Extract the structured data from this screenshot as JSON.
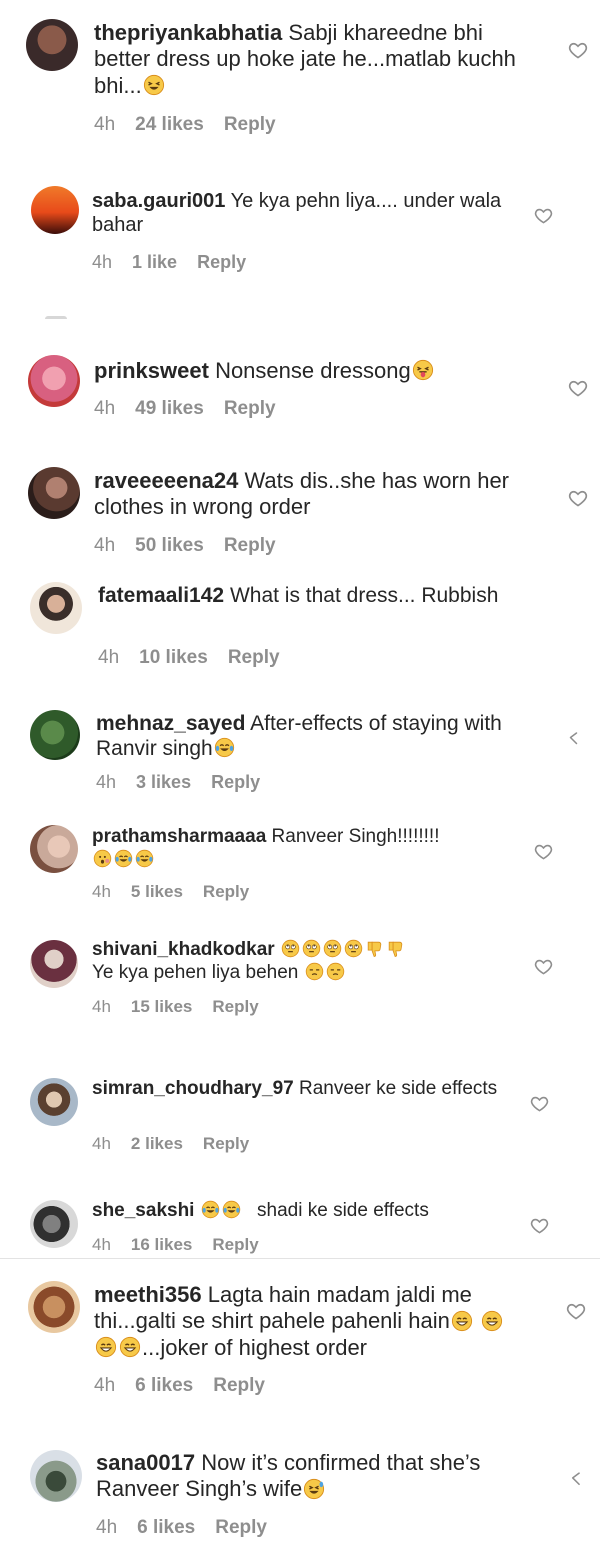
{
  "comments": [
    {
      "username": "thepriyankabhatia",
      "text": "Sabji khareedne bhi better dress up hoke jate he...matlab kuchh bhi...",
      "emoji_after": [
        "laughing-squint-emoji"
      ],
      "time": "4h",
      "likes": "24 likes",
      "reply": "Reply",
      "avatar_colors": [
        "#3a2a2a",
        "#8a5a4a"
      ]
    },
    {
      "username": "saba.gauri001",
      "text": "Ye kya pehn liya.... under wala bahar",
      "emoji_after": [],
      "time": "4h",
      "likes": "1 like",
      "reply": "Reply",
      "avatar_colors": [
        "#e85a1a",
        "#3b0d0a"
      ]
    },
    {
      "username": "prinksweet",
      "text": "Nonsense dressong",
      "emoji_after": [
        "squinting-tongue-emoji"
      ],
      "time": "4h",
      "likes": "49 likes",
      "reply": "Reply",
      "avatar_colors": [
        "#d86080",
        "#c43a3a"
      ]
    },
    {
      "username": "raveeeeena24",
      "text": "Wats dis..she has worn her clothes in wrong order",
      "emoji_after": [],
      "time": "4h",
      "likes": "50 likes",
      "reply": "Reply",
      "avatar_colors": [
        "#2b1d1a",
        "#7a5a4f"
      ]
    },
    {
      "username": "fatemaali142",
      "text": "What is that dress... Rubbish",
      "emoji_after": [],
      "time": "4h",
      "likes": "10 likes",
      "reply": "Reply",
      "avatar_colors": [
        "#f0e6da",
        "#3a2e2a"
      ]
    },
    {
      "username": "mehnaz_sayed",
      "text": "After-effects of staying with Ranvir singh",
      "emoji_after": [
        "tears-of-joy-emoji"
      ],
      "time": "4h",
      "likes": "3 likes",
      "reply": "Reply",
      "avatar_colors": [
        "#2f5a2a",
        "#1c3b1a"
      ]
    },
    {
      "username": "prathamsharmaaaa",
      "text": "Ranveer Singh!!!!!!!!",
      "emoji_after": [
        "hushed-emoji",
        "tears-of-joy-emoji",
        "tears-of-joy-emoji"
      ],
      "time": "4h",
      "likes": "5 likes",
      "reply": "Reply",
      "avatar_colors": [
        "#c9a99a",
        "#7a5040"
      ]
    },
    {
      "username": "shivani_khadkodkar",
      "text": "Ye kya pehen liya behen",
      "emoji_before": [
        "eye-roll-emoji",
        "eye-roll-emoji",
        "eye-roll-emoji",
        "eye-roll-emoji",
        "thumbs-down-emoji",
        "thumbs-down-emoji"
      ],
      "emoji_after": [
        "unamused-emoji",
        "unamused-emoji"
      ],
      "time": "4h",
      "likes": "15 likes",
      "reply": "Reply",
      "avatar_colors": [
        "#e0d0c8",
        "#6a3040"
      ]
    },
    {
      "username": "simran_choudhary_97",
      "text": "Ranveer ke side effects",
      "emoji_after": [],
      "time": "4h",
      "likes": "2 likes",
      "reply": "Reply",
      "avatar_colors": [
        "#a8b8c8",
        "#5a4030"
      ]
    },
    {
      "username": "she_sakshi",
      "text": "shadi ke side effects",
      "emoji_before": [
        "tears-of-joy-emoji",
        "tears-of-joy-emoji"
      ],
      "emoji_after": [],
      "time": "4h",
      "likes": "16 likes",
      "reply": "Reply",
      "avatar_colors": [
        "#d8d8d8",
        "#303030"
      ]
    },
    {
      "username": "meethi356",
      "text": "Lagta hain madam jaldi me thi...galti se shirt pahele pahenli hain",
      "emoji_after": [
        "grinning-emoji",
        "grinning-emoji",
        "grinning-emoji",
        "grinning-emoji"
      ],
      "text_tail": "...joker of highest order",
      "time": "4h",
      "likes": "6 likes",
      "reply": "Reply",
      "avatar_colors": [
        "#c89060",
        "#8a4a2a"
      ]
    },
    {
      "username": "sana0017",
      "text": "Now it’s confirmed that she’s Ranveer Singh’s wife",
      "emoji_after": [
        "rolling-laughing-emoji"
      ],
      "time": "4h",
      "likes": "6 likes",
      "reply": "Reply",
      "avatar_colors": [
        "#d9dfe6",
        "#3a4a3a"
      ]
    }
  ],
  "colors": {
    "text": "#262626",
    "meta": "#8e8e8e",
    "emoji_face": "#f7c948",
    "emoji_edge": "#d98e1b"
  }
}
